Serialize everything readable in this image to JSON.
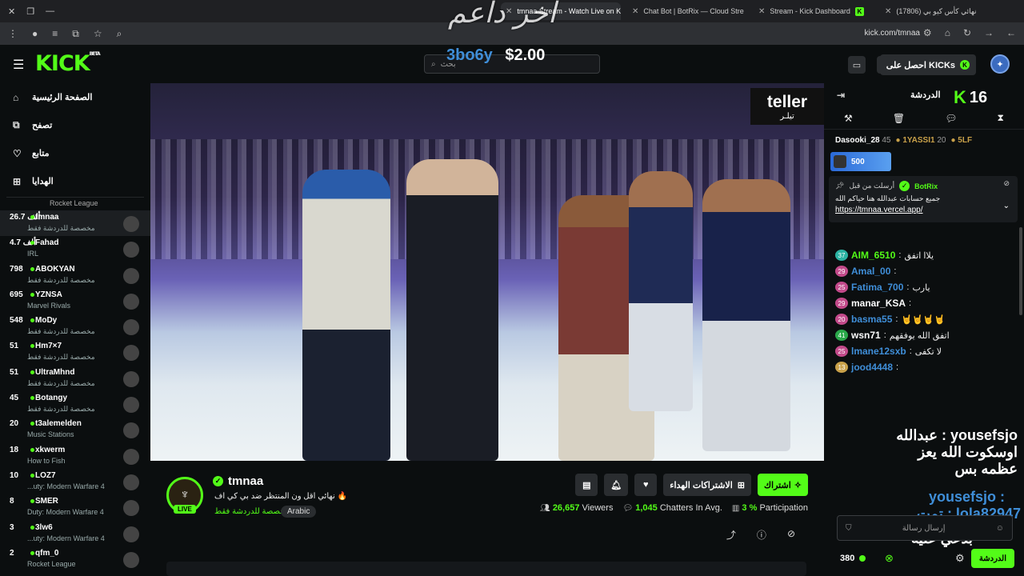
{
  "browser": {
    "tabs": [
      {
        "label": "tmnaa Stream - Watch Live on Kick"
      },
      {
        "label": "Chat Bot | BotRix — Cloud Stre"
      },
      {
        "label": "Stream - Kick Dashboard"
      },
      {
        "label": "(17806) نهائي كأس كيو بي"
      }
    ],
    "url": "kick.com/tmnaa"
  },
  "overlay": {
    "title": "اخر داعم",
    "donor": "3bo6y",
    "amount": "$2.00"
  },
  "header": {
    "logo": "KICK",
    "logo_sup": "BETA",
    "search_placeholder": "بحث",
    "get_kicks": "احصل على KICKs"
  },
  "sidebar": {
    "nav": [
      {
        "label": "الصفحة الرئيسية",
        "icon": "home-icon"
      },
      {
        "label": "تصفح",
        "icon": "browse-icon"
      },
      {
        "label": "متابع",
        "icon": "heart-icon"
      },
      {
        "label": "الهدايا",
        "icon": "gift-icon"
      }
    ],
    "top_category": "Rocket League",
    "channels": [
      {
        "count": "26.7 ألف",
        "name": "tmnaa",
        "category": "مخصصة للدردشة فقط"
      },
      {
        "count": "4.7 ألف",
        "name": "Fahad",
        "category": "IRL"
      },
      {
        "count": "798",
        "name": "ABOKYAN",
        "category": "مخصصة للدردشة فقط"
      },
      {
        "count": "695",
        "name": "YZNSA",
        "category": "Marvel Rivals"
      },
      {
        "count": "548",
        "name": "MoDy",
        "category": "مخصصة للدردشة فقط"
      },
      {
        "count": "51",
        "name": "Hm7×7",
        "category": "مخصصة للدردشة فقط"
      },
      {
        "count": "51",
        "name": "UltraMhnd",
        "category": "مخصصة للدردشة فقط"
      },
      {
        "count": "45",
        "name": "Botangy",
        "category": "مخصصة للدردشة فقط"
      },
      {
        "count": "20",
        "name": "t3alemelden",
        "category": "Music Stations"
      },
      {
        "count": "18",
        "name": "xkwerm",
        "category": "How to Fish"
      },
      {
        "count": "10",
        "name": "LOZ7",
        "category": "...uty: Modern Warfare 4"
      },
      {
        "count": "8",
        "name": "SMER",
        "category": "Duty: Modern Warfare 4"
      },
      {
        "count": "3",
        "name": "3lw6",
        "category": "...uty: Modern Warfare 4"
      },
      {
        "count": "2",
        "name": "qfm_0",
        "category": "Rocket League"
      }
    ]
  },
  "video": {
    "sponsor": "teller",
    "sponsor_ar": "تيلـر"
  },
  "channel": {
    "name": "tmnaa",
    "live": "LIVE",
    "title": "نهائي اقل ون المنتظر ضد بي كي اف 🔥",
    "category": "مخصصة للدردشة فقط",
    "tag": "Arabic",
    "subscribe": "اشتراك",
    "gift_subs": "الاشتراكات الهداء",
    "viewers": "26,657",
    "viewers_label": "Viewers",
    "chatters": "1,045",
    "chatters_label": "Chatters In Avg.",
    "participation": "3 %",
    "participation_label": "Participation"
  },
  "chat": {
    "header": "الدردشة",
    "kick_count": "16",
    "gifters": [
      {
        "name": "Dasooki_28",
        "count": "45"
      },
      {
        "name": "1YASSI1",
        "count": "20"
      },
      {
        "name": "5LF",
        "count": ""
      }
    ],
    "goal": "500",
    "pinned": {
      "by": "أرسلت من قبل",
      "bot": "BotRix",
      "message": "جميع حسابات عبدالله هنا حياكم الله",
      "url": "https://tmnaa.vercel.app/"
    },
    "messages": [
      {
        "badge": "37",
        "user": "AIM_6510",
        "text": "يلاا اتفق",
        "color": "#53fc18"
      },
      {
        "badge": "29",
        "user": "Amal_00",
        "text": "",
        "color": "#3f8ed8"
      },
      {
        "badge": "25",
        "user": "Fatima_700",
        "text": "يارب",
        "color": "#3f8ed8"
      },
      {
        "badge": "29",
        "user": "manar_KSA",
        "text": "",
        "color": "#ffffff"
      },
      {
        "badge": "20",
        "user": "basma55",
        "text": "🤘🤘🤘🤘",
        "color": "#3f8ed8"
      },
      {
        "badge": "41",
        "user": "wsn71",
        "text": "اتفق الله يوفقهم",
        "color": "#ffffff"
      },
      {
        "badge": "25",
        "user": "lmane12sxb",
        "text": "لا تكفى",
        "color": "#3f8ed8"
      },
      {
        "badge": "13",
        "user": "jood4448",
        "text": "",
        "color": "#3f8ed8"
      }
    ],
    "overlay_lines": [
      "عبدالله : yousefsjo",
      "اوسكوت الله يعز عظمه بس",
      "yousefsjo :",
      "تمت : lola82947",
      "بدعي عليه"
    ],
    "input_placeholder": "إرسال رسالة",
    "points": "380",
    "send": "الدردشة"
  }
}
